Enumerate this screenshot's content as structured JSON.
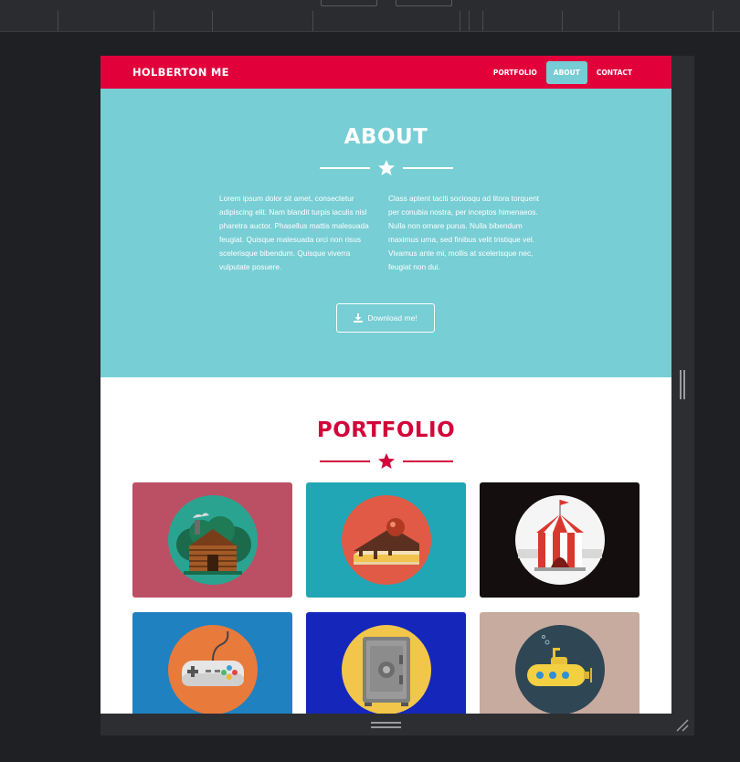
{
  "nav": {
    "brand": "HOLBERTON ME",
    "links": [
      {
        "label": "PORTFOLIO",
        "active": false
      },
      {
        "label": "ABOUT",
        "active": true
      },
      {
        "label": "CONTACT",
        "active": false
      }
    ]
  },
  "about": {
    "title": "ABOUT",
    "col1": "Lorem ipsum dolor sit amet, consectetur adipiscing elit. Nam blandit turpis iaculis nisl pharetra auctor. Phasellus mattis malesuada feugiat. Quisque malesuada orci non risus scelerisque bibendum. Quisque viverra vulputate posuere.",
    "col2": "Class aptent taciti sociosqu ad litora torquent per conubia nostra, per inceptos himenaeos. Nulla non ornare purus. Nulla bibendum maximus urna, sed finibus velit tristique vel. Vivamus ante mi, mollis at scelerisque nec, feugiat non dui.",
    "button_label": "Download me!",
    "button_icon": "download-icon"
  },
  "portfolio": {
    "title": "PORTFOLIO",
    "tiles": [
      {
        "name": "cabin",
        "icon": "cabin-icon",
        "bg": "#bb5064"
      },
      {
        "name": "cake",
        "icon": "cake-icon",
        "bg": "#20a6b5"
      },
      {
        "name": "circus",
        "icon": "circus-tent-icon",
        "bg": "#140e0f"
      },
      {
        "name": "game",
        "icon": "game-controller-icon",
        "bg": "#1f81c0"
      },
      {
        "name": "safe",
        "icon": "safe-icon",
        "bg": "#1427ba"
      },
      {
        "name": "submarine",
        "icon": "submarine-icon",
        "bg": "#c7ab9e"
      }
    ]
  },
  "colors": {
    "nav_red": "#e2003b",
    "about_teal": "#77ced4",
    "portfolio_red": "#d2063a"
  }
}
